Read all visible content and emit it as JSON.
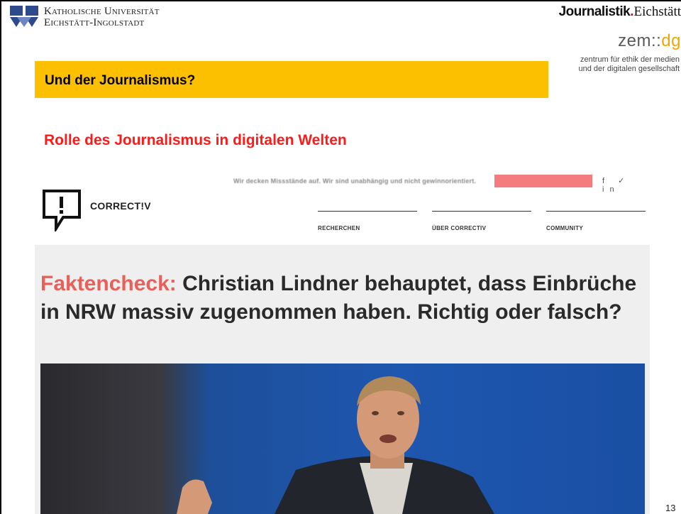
{
  "header": {
    "university_line1": "Katholische Universität",
    "university_line2": "Eichstätt-Ingolstadt",
    "journalistik_bold": "Journalistik",
    "journalistik_dot": ".",
    "journalistik_rest": "Eichstätt",
    "zem_main": "zem::",
    "zem_dg": "dg",
    "zem_sub_line1": "zentrum für ethik der medien",
    "zem_sub_line2": "und der digitalen gesellschaft"
  },
  "slide": {
    "heading": "Und der Journalismus?",
    "subtitle": "Rolle des Journalismus in digitalen Welten",
    "page_number": "13"
  },
  "screenshot": {
    "top_strip_text": "Wir decken Missstände auf. Wir sind unabhängig und nicht gewinnorientiert.",
    "social_icons": "f ✓ in",
    "brand": "CORRECT!V",
    "nav": [
      "RECHERCHEN",
      "ÜBER CORRECTIV",
      "COMMUNITY"
    ],
    "headline_prefix": "Faktencheck:",
    "headline_rest": " Christian Lindner behauptet, dass Einbrüche in NRW massiv zugenommen haben. Richtig oder falsch?"
  },
  "colors": {
    "heading_bar": "#fcc000",
    "subtitle": "#ff1a1a",
    "faktencheck": "#e8605a",
    "dot": "#e30613",
    "zem_dg": "#f0a800"
  }
}
